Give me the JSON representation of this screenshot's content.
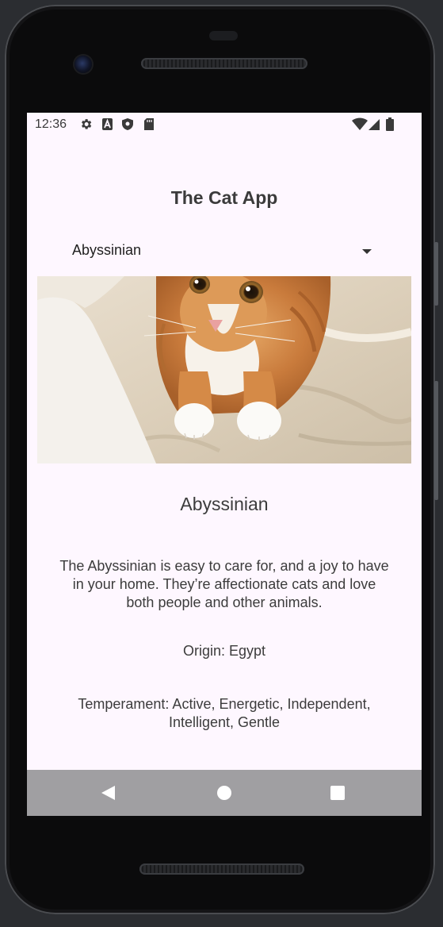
{
  "status_bar": {
    "time": "12:36",
    "left_icons": [
      "gear-icon",
      "text-icon",
      "shield-icon",
      "sd-card-icon"
    ],
    "right_icons": [
      "wifi-icon",
      "signal-icon",
      "battery-icon"
    ]
  },
  "app": {
    "title": "The Cat App",
    "breed_select": {
      "selected": "Abyssinian"
    },
    "image_icon": "cat-photo",
    "breed": {
      "name": "Abyssinian",
      "description": "The Abyssinian is easy to care for, and a joy to have in your home. They’re affectionate cats and love both people and other animals.",
      "origin": "Origin: Egypt",
      "temperament": "Temperament: Active, Energetic, Independent, Intelligent, Gentle"
    }
  },
  "nav_bar": {
    "buttons": [
      "back-icon",
      "home-icon",
      "recents-icon"
    ]
  },
  "colors": {
    "screen_background": "#fef7ff",
    "nav_bar": "#a09fa2",
    "text": "#3c3c3c"
  }
}
